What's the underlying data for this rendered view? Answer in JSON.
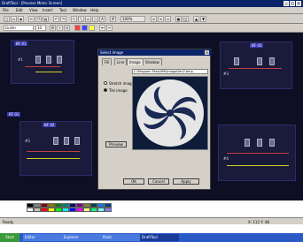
{
  "app": {
    "title": "DraftTool - [Process Mimic Screen]",
    "zoom": "100%"
  },
  "menu": [
    "File",
    "Edit",
    "View",
    "Insert",
    "Tool",
    "Window",
    "Help"
  ],
  "toolbar": {
    "font_name": "Gulim",
    "font_size": "10"
  },
  "canvas": {
    "labels": [
      "BF 01",
      "BF 02",
      "BF 03",
      "RF 01",
      "#1",
      "#2",
      "#3",
      "#4"
    ]
  },
  "dialog": {
    "title": "Select Image",
    "tabs": [
      "Fill",
      "Line",
      "Image",
      "Shadow"
    ],
    "options": [
      "Stretch image",
      "Tile image"
    ],
    "path": "C:\\Program Files\\HMI\\Image\\Fan2.bmp",
    "preview_btn": "Preview",
    "ok": "OK",
    "cancel": "Cancel",
    "apply": "Apply"
  },
  "palette": {
    "colors": [
      "#000000",
      "#808080",
      "#800000",
      "#808000",
      "#008000",
      "#008080",
      "#000080",
      "#800080",
      "#808040",
      "#004040",
      "#0080ff",
      "#004080",
      "#8000ff",
      "#804000",
      "#ffffff",
      "#c0c0c0",
      "#ff0000",
      "#ffff00",
      "#00ff00",
      "#00ffff",
      "#0000ff",
      "#ff00ff",
      "#ffff80",
      "#00ff80"
    ]
  },
  "status": {
    "text": "Ready",
    "coords": "X: 112 Y: 48"
  },
  "taskbar": {
    "start": "Start",
    "tasks": [
      "Editor",
      "Explorer",
      "Paint",
      "DraftTool"
    ]
  },
  "colors": {
    "canvas_bg": "#0e0e24",
    "accent": "#0a246a",
    "fan_bg": "#0e1c3a",
    "fan_blade": "#e6e6e6"
  }
}
